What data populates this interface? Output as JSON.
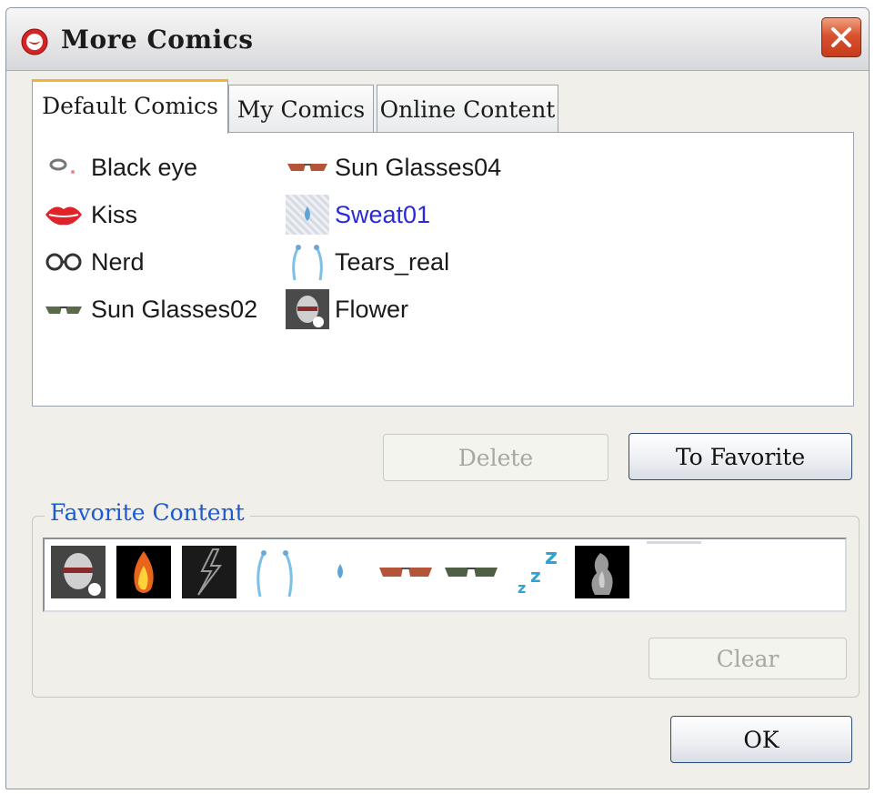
{
  "window": {
    "title": "More Comics"
  },
  "tabs": [
    {
      "label": "Default Comics",
      "active": true
    },
    {
      "label": "My Comics",
      "active": false
    },
    {
      "label": "Online Content",
      "active": false
    }
  ],
  "comics": [
    {
      "label": "Black eye",
      "icon": "black-eye-icon"
    },
    {
      "label": "Kiss",
      "icon": "lips-icon"
    },
    {
      "label": "Nerd",
      "icon": "nerd-glasses-icon"
    },
    {
      "label": "Sun Glasses02",
      "icon": "sunglasses-icon"
    },
    {
      "label": "Sun Glasses04",
      "icon": "sunglasses-icon"
    },
    {
      "label": "Sweat01",
      "icon": "sweat-drop-icon",
      "selected": true
    },
    {
      "label": "Tears_real",
      "icon": "tears-icon"
    },
    {
      "label": "Flower",
      "icon": "head-thumbnail-icon"
    }
  ],
  "buttons": {
    "delete": "Delete",
    "to_favorite": "To Favorite",
    "clear": "Clear",
    "ok": "OK"
  },
  "favorite": {
    "label": "Favorite Content",
    "items": [
      "head-thumbnail-icon",
      "fire-icon",
      "lightning-icon",
      "tears-icon",
      "sweat-drop-icon",
      "sunglasses-icon",
      "sunglasses-dark-icon",
      "sleep-zzz-icon",
      "smoke-icon"
    ]
  },
  "colors": {
    "accent_tab": "#f3b33b",
    "selected_text": "#2a2ad8",
    "group_label": "#1c5bcf",
    "close": "#d8532f"
  }
}
